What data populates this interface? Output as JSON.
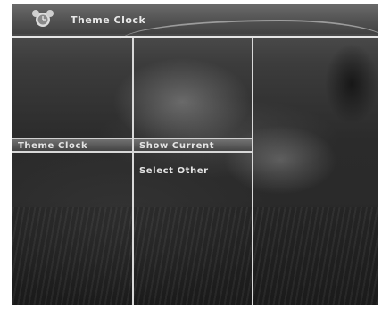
{
  "header": {
    "title": "Theme Clock",
    "icon": "clock-icon"
  },
  "columns": [
    {
      "items": [
        {
          "label": "Theme Clock",
          "selected": true
        }
      ]
    },
    {
      "items": [
        {
          "label": "Show Current",
          "selected": true
        },
        {
          "label": "Select Other",
          "selected": false
        }
      ]
    },
    {
      "items": []
    }
  ],
  "colors": {
    "divider": "#d8d8d8",
    "text": "#e4e4e4",
    "highlight": "#6e6e6e"
  }
}
